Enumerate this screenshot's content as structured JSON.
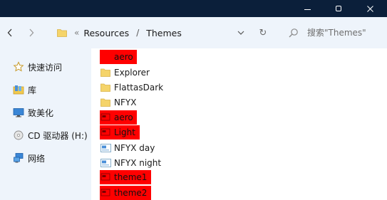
{
  "colors": {
    "titlebar": "#0b1f3a",
    "pane": "#eef4fb",
    "folder": "#f5d46a",
    "redaction": "#ff0000"
  },
  "titlebar": {
    "minimize_icon": "minimize-icon",
    "maximize_icon": "maximize-icon",
    "close_icon": "close-icon"
  },
  "address": {
    "overflow": "«",
    "crumbs": [
      "Resources",
      "Themes"
    ],
    "separator": "/",
    "refresh_glyph": "↻"
  },
  "search": {
    "placeholder": "搜索\"Themes\""
  },
  "sidebar": {
    "items": [
      {
        "label": "快速访问",
        "icon": "star-icon"
      },
      {
        "label": "库",
        "icon": "library-icon"
      },
      {
        "label": "致美化",
        "icon": "desktop-icon"
      },
      {
        "label": "CD 驱动器 (H:)",
        "icon": "cd-drive-icon"
      },
      {
        "label": "网络",
        "icon": "network-icon"
      }
    ]
  },
  "files": [
    {
      "label": "aero",
      "type": "redacted"
    },
    {
      "label": "Explorer",
      "type": "folder"
    },
    {
      "label": "FlattasDark",
      "type": "folder"
    },
    {
      "label": "NFYX",
      "type": "folder"
    },
    {
      "label": "aero",
      "type": "theme-redacted"
    },
    {
      "label": "Light",
      "type": "theme-redacted"
    },
    {
      "label": "NFYX day",
      "type": "theme"
    },
    {
      "label": "NFYX night",
      "type": "theme"
    },
    {
      "label": "theme1",
      "type": "theme-redacted"
    },
    {
      "label": "theme2",
      "type": "theme-redacted"
    }
  ]
}
